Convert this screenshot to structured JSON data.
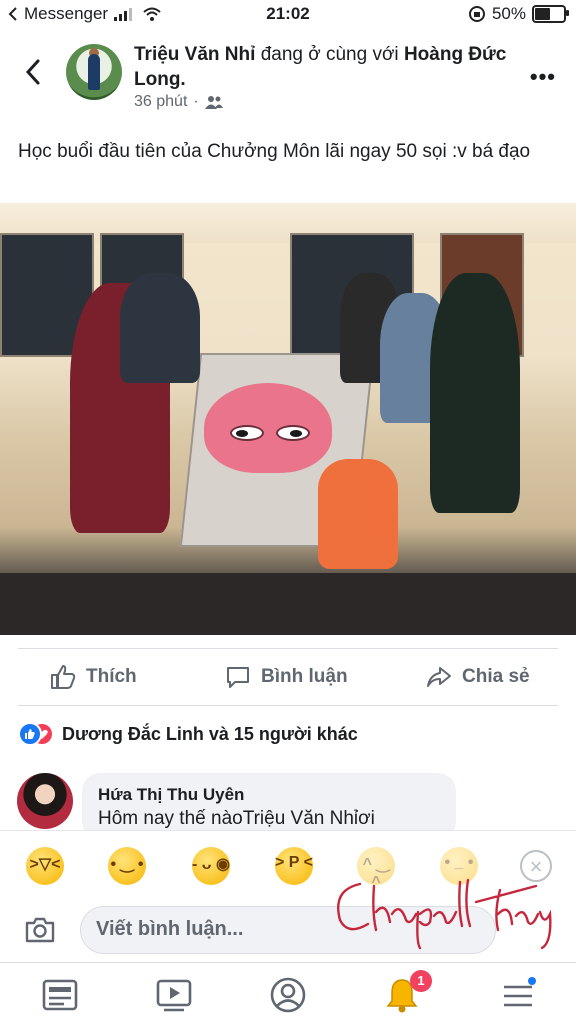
{
  "status_bar": {
    "carrier": "Messenger",
    "time": "21:02",
    "battery": "50%"
  },
  "post": {
    "author": "Triệu Văn Nhỉ",
    "with_text": "đang ở cùng với",
    "tagged": "Hoàng Đức Long.",
    "time": "36 phút",
    "privacy_icon": "friends-icon",
    "text": "Học buổi đầu tiên của Chưởng Môn lãi ngay 50 sọi :v bá đạo"
  },
  "actions": {
    "like": "Thích",
    "comment": "Bình luận",
    "share": "Chia sẻ"
  },
  "reactions": {
    "summary": "Dương Đắc Linh và 15 người khác"
  },
  "comment": {
    "name": "Hứa Thị Thu Uyên",
    "text": "Hôm nay thế nàoTriệu Văn Nhỉơi"
  },
  "composer": {
    "placeholder": "Viết bình luận..."
  },
  "watermark": {
    "text": "ChapallThay"
  },
  "tabbar": {
    "notification_count": "1"
  },
  "colors": {
    "accent": "#1877f2",
    "love": "#f33e58",
    "badge": "#f3425f"
  }
}
